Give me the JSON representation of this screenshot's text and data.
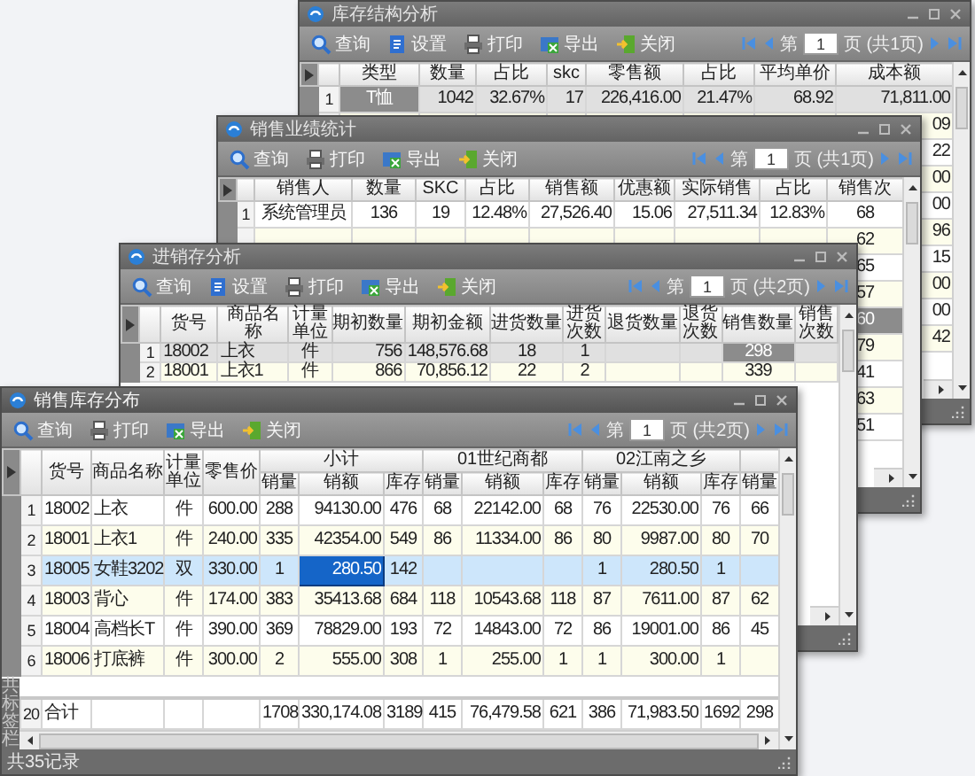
{
  "windows": [
    {
      "title": "库存结构分析",
      "active": false,
      "toolbar": [
        {
          "kind": "search",
          "label": "查询"
        },
        {
          "kind": "settings",
          "label": "设置"
        },
        {
          "kind": "print",
          "label": "打印"
        },
        {
          "kind": "export",
          "label": "导出"
        },
        {
          "kind": "close",
          "label": "关闭"
        }
      ],
      "pager": {
        "prefix": "第",
        "page": "1",
        "suffix": "页 (共1页)"
      },
      "columns": [
        {
          "label": "类型"
        },
        {
          "label": "数量"
        },
        {
          "label": "占比"
        },
        {
          "label": "skc"
        },
        {
          "label": "零售额"
        },
        {
          "label": "占比"
        },
        {
          "label": "平均单价"
        },
        {
          "label": "成本额"
        }
      ],
      "rows": [
        {
          "number": "1",
          "selected": true,
          "cells": [
            {
              "text": "T恤",
              "current": true
            },
            "1042",
            "32.67%",
            "17",
            "226,416.00",
            "21.47%",
            "68.92",
            "71,811.00"
          ]
        },
        {
          "selected": false,
          "cells": [
            null,
            null,
            null,
            null,
            null,
            null,
            null,
            "09"
          ]
        },
        {
          "selected": false,
          "cells": [
            null,
            null,
            null,
            null,
            null,
            null,
            null,
            "22"
          ]
        },
        {
          "selected": false,
          "cells": [
            null,
            null,
            null,
            null,
            null,
            null,
            null,
            "00"
          ]
        },
        {
          "selected": false,
          "cells": [
            null,
            null,
            null,
            null,
            null,
            null,
            null,
            "00"
          ]
        },
        {
          "selected": false,
          "cells": [
            null,
            null,
            null,
            null,
            null,
            null,
            null,
            "96"
          ]
        },
        {
          "selected": false,
          "cells": [
            null,
            null,
            null,
            null,
            null,
            null,
            null,
            "15"
          ]
        },
        {
          "selected": false,
          "cells": [
            null,
            null,
            null,
            null,
            null,
            null,
            null,
            "00"
          ]
        },
        {
          "selected": false,
          "cells": [
            null,
            null,
            null,
            null,
            null,
            null,
            null,
            "00"
          ]
        },
        {
          "selected": false,
          "cells": [
            null,
            null,
            null,
            null,
            null,
            null,
            null,
            "42"
          ]
        }
      ]
    },
    {
      "title": "销售业绩统计",
      "active": false,
      "toolbar": [
        {
          "kind": "search",
          "label": "查询"
        },
        {
          "kind": "print",
          "label": "打印"
        },
        {
          "kind": "export",
          "label": "导出"
        },
        {
          "kind": "close",
          "label": "关闭"
        }
      ],
      "pager": {
        "prefix": "第",
        "page": "1",
        "suffix": "页 (共1页)"
      },
      "columns": [
        {
          "label": "销售人"
        },
        {
          "label": "数量"
        },
        {
          "label": "SKC"
        },
        {
          "label": "占比"
        },
        {
          "label": "销售额"
        },
        {
          "label": "优惠额"
        },
        {
          "label": "实际销售"
        },
        {
          "label": "占比"
        },
        {
          "label": "销售次"
        }
      ],
      "rows": [
        {
          "number": "1",
          "selected": false,
          "cells": [
            "系统管理员",
            "136",
            "19",
            "12.48%",
            "27,526.40",
            "15.06",
            "27,511.34",
            "12.83%",
            "68"
          ]
        },
        {
          "selected": false,
          "cells": [
            null,
            null,
            null,
            null,
            null,
            null,
            null,
            null,
            "62"
          ]
        },
        {
          "selected": false,
          "cells": [
            null,
            null,
            null,
            null,
            null,
            null,
            null,
            null,
            "65"
          ]
        },
        {
          "selected": false,
          "cells": [
            null,
            null,
            null,
            null,
            null,
            null,
            null,
            null,
            "57"
          ]
        },
        {
          "selected": true,
          "cells": [
            null,
            null,
            null,
            null,
            null,
            null,
            null,
            null,
            {
              "text": "60",
              "current": true
            }
          ]
        },
        {
          "selected": false,
          "cells": [
            null,
            null,
            null,
            null,
            null,
            null,
            null,
            null,
            "79"
          ]
        },
        {
          "selected": false,
          "cells": [
            null,
            null,
            null,
            null,
            null,
            null,
            null,
            null,
            "41"
          ]
        },
        {
          "selected": false,
          "cells": [
            null,
            null,
            null,
            null,
            null,
            null,
            null,
            null,
            "63"
          ]
        },
        {
          "selected": false,
          "cells": [
            null,
            null,
            null,
            null,
            null,
            null,
            null,
            null,
            "51"
          ]
        }
      ]
    },
    {
      "title": "进销存分析",
      "active": false,
      "toolbar": [
        {
          "kind": "search",
          "label": "查询"
        },
        {
          "kind": "settings",
          "label": "设置"
        },
        {
          "kind": "print",
          "label": "打印"
        },
        {
          "kind": "export",
          "label": "导出"
        },
        {
          "kind": "close",
          "label": "关闭"
        }
      ],
      "pager": {
        "prefix": "第",
        "page": "1",
        "suffix": "页 (共2页)"
      },
      "columns": [
        {
          "label": "货号"
        },
        {
          "label": "商品名称"
        },
        {
          "label": "计量单位"
        },
        {
          "label": "期初数量"
        },
        {
          "label": "期初金额"
        },
        {
          "label": "进货数量"
        },
        {
          "label": "进货次数"
        },
        {
          "label": "退货数量"
        },
        {
          "label": "退货次数"
        },
        {
          "label": "销售数量"
        },
        {
          "label": "销售次数"
        }
      ],
      "rows": [
        {
          "number": "1",
          "selected": true,
          "cells": [
            "18002",
            "上衣",
            "件",
            "756",
            "148,576.68",
            "18",
            "1",
            null,
            null,
            {
              "text": "298",
              "current": true
            },
            null
          ]
        },
        {
          "number": "2",
          "selected": false,
          "cells": [
            "18001",
            "上衣1",
            "件",
            "866",
            "70,856.12",
            "22",
            "2",
            null,
            null,
            "339",
            null
          ]
        }
      ]
    },
    {
      "title": "销售库存分布",
      "active": true,
      "toolbar": [
        {
          "kind": "search",
          "label": "查询"
        },
        {
          "kind": "print",
          "label": "打印"
        },
        {
          "kind": "export",
          "label": "导出"
        },
        {
          "kind": "close",
          "label": "关闭"
        }
      ],
      "pager": {
        "prefix": "第",
        "page": "1",
        "suffix": "页 (共2页)"
      },
      "columns": [
        {
          "label": "货号"
        },
        {
          "label": "商品名称"
        },
        {
          "label": "计量单位"
        },
        {
          "label": "零售价"
        },
        {
          "label": "小计",
          "colspan": 3,
          "columns": [
            {
              "label": "销量"
            },
            {
              "label": "销额"
            },
            {
              "label": "库存"
            }
          ]
        },
        {
          "label": "01世纪商都",
          "colspan": 3,
          "columns": [
            {
              "label": "销量"
            },
            {
              "label": "销额"
            },
            {
              "label": "库存"
            }
          ]
        },
        {
          "label": "02江南之乡",
          "colspan": 3,
          "columns": [
            {
              "label": "销量"
            },
            {
              "label": "销额"
            },
            {
              "label": "库存"
            }
          ]
        },
        {
          "columns": [
            {
              "label": "销量"
            }
          ]
        }
      ],
      "rows": [
        {
          "number": "1",
          "selected": false,
          "cells": [
            "18002",
            "上衣",
            "件",
            "600.00",
            "288",
            "94130.00",
            "476",
            "68",
            "22142.00",
            "68",
            "76",
            "22530.00",
            "76",
            "66"
          ]
        },
        {
          "number": "2",
          "selected": false,
          "cells": [
            "18001",
            "上衣1",
            "件",
            "240.00",
            "335",
            "42354.00",
            "549",
            "86",
            "11334.00",
            "86",
            "80",
            "9987.00",
            "80",
            "70"
          ]
        },
        {
          "number": "3",
          "selected": true,
          "cells": [
            "18005",
            "女鞋3202",
            "双",
            "330.00",
            "1",
            {
              "text": "280.50",
              "current": true
            },
            "142",
            null,
            null,
            null,
            "1",
            "280.50",
            "1",
            null
          ]
        },
        {
          "number": "4",
          "selected": false,
          "cells": [
            "18003",
            "背心",
            "件",
            "174.00",
            "383",
            "35413.68",
            "684",
            "118",
            "10543.68",
            "118",
            "87",
            "7611.00",
            "87",
            "62"
          ]
        },
        {
          "number": "5",
          "selected": false,
          "cells": [
            "18004",
            "高档长T",
            "件",
            "390.00",
            "369",
            "78829.00",
            "193",
            "72",
            "14843.00",
            "72",
            "86",
            "19001.00",
            "86",
            "45"
          ]
        },
        {
          "number": "6",
          "selected": false,
          "cells": [
            "18006",
            "打底裤",
            "件",
            "300.00",
            "2",
            "555.00",
            "308",
            "1",
            "255.00",
            "1",
            "1",
            "300.00",
            "1",
            null
          ]
        }
      ],
      "footer": {
        "number": "20",
        "cells": [
          "合计",
          null,
          null,
          null,
          "1708",
          "330,174.08",
          "3189",
          "415",
          "76,479.58",
          "621",
          "386",
          "71,983.50",
          "1692",
          "298"
        ]
      },
      "side_label": "共标签栏",
      "status": "共35记录"
    }
  ]
}
